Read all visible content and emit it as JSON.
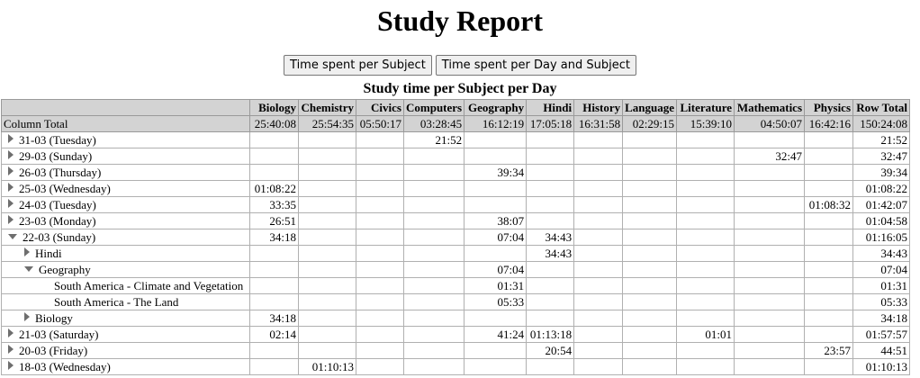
{
  "title": "Study Report",
  "buttons": {
    "per_subject": "Time spent per Subject",
    "per_day_subject": "Time spent per Day and Subject"
  },
  "table_caption": "Study time per Subject per Day",
  "columns": [
    "Biology",
    "Chemistry",
    "Civics",
    "Computers",
    "Geography",
    "Hindi",
    "History",
    "Language",
    "Literature",
    "Mathematics",
    "Physics",
    "Row Total"
  ],
  "totals": {
    "label": "Column Total",
    "values": [
      "25:40:08",
      "25:54:35",
      "05:50:17",
      "03:28:45",
      "16:12:19",
      "17:05:18",
      "16:31:58",
      "02:29:15",
      "15:39:10",
      "04:50:07",
      "16:42:16",
      "150:24:08"
    ]
  },
  "rows": [
    {
      "label": "31-03 (Tuesday)",
      "level": 0,
      "toggle": "closed",
      "cells": [
        "",
        "",
        "",
        "21:52",
        "",
        "",
        "",
        "",
        "",
        "",
        "",
        "21:52"
      ]
    },
    {
      "label": "29-03 (Sunday)",
      "level": 0,
      "toggle": "closed",
      "cells": [
        "",
        "",
        "",
        "",
        "",
        "",
        "",
        "",
        "",
        "32:47",
        "",
        "32:47"
      ]
    },
    {
      "label": "26-03 (Thursday)",
      "level": 0,
      "toggle": "closed",
      "cells": [
        "",
        "",
        "",
        "",
        "39:34",
        "",
        "",
        "",
        "",
        "",
        "",
        "39:34"
      ]
    },
    {
      "label": "25-03 (Wednesday)",
      "level": 0,
      "toggle": "closed",
      "cells": [
        "01:08:22",
        "",
        "",
        "",
        "",
        "",
        "",
        "",
        "",
        "",
        "",
        "01:08:22"
      ]
    },
    {
      "label": "24-03 (Tuesday)",
      "level": 0,
      "toggle": "closed",
      "cells": [
        "33:35",
        "",
        "",
        "",
        "",
        "",
        "",
        "",
        "",
        "",
        "01:08:32",
        "01:42:07"
      ]
    },
    {
      "label": "23-03 (Monday)",
      "level": 0,
      "toggle": "closed",
      "cells": [
        "26:51",
        "",
        "",
        "",
        "38:07",
        "",
        "",
        "",
        "",
        "",
        "",
        "01:04:58"
      ]
    },
    {
      "label": "22-03 (Sunday)",
      "level": 0,
      "toggle": "open",
      "cells": [
        "34:18",
        "",
        "",
        "",
        "07:04",
        "34:43",
        "",
        "",
        "",
        "",
        "",
        "01:16:05"
      ]
    },
    {
      "label": "Hindi",
      "level": 1,
      "toggle": "closed",
      "cells": [
        "",
        "",
        "",
        "",
        "",
        "34:43",
        "",
        "",
        "",
        "",
        "",
        "34:43"
      ]
    },
    {
      "label": "Geography",
      "level": 1,
      "toggle": "open",
      "cells": [
        "",
        "",
        "",
        "",
        "07:04",
        "",
        "",
        "",
        "",
        "",
        "",
        "07:04"
      ]
    },
    {
      "label": "South America - Climate and Vegetation",
      "level": 2,
      "toggle": "none",
      "cells": [
        "",
        "",
        "",
        "",
        "01:31",
        "",
        "",
        "",
        "",
        "",
        "",
        "01:31"
      ]
    },
    {
      "label": "South America - The Land",
      "level": 2,
      "toggle": "none",
      "cells": [
        "",
        "",
        "",
        "",
        "05:33",
        "",
        "",
        "",
        "",
        "",
        "",
        "05:33"
      ]
    },
    {
      "label": "Biology",
      "level": 1,
      "toggle": "closed",
      "cells": [
        "34:18",
        "",
        "",
        "",
        "",
        "",
        "",
        "",
        "",
        "",
        "",
        "34:18"
      ]
    },
    {
      "label": "21-03 (Saturday)",
      "level": 0,
      "toggle": "closed",
      "cells": [
        "02:14",
        "",
        "",
        "",
        "41:24",
        "01:13:18",
        "",
        "",
        "01:01",
        "",
        "",
        "01:57:57"
      ]
    },
    {
      "label": "20-03 (Friday)",
      "level": 0,
      "toggle": "closed",
      "cells": [
        "",
        "",
        "",
        "",
        "",
        "20:54",
        "",
        "",
        "",
        "",
        "23:57",
        "44:51"
      ]
    },
    {
      "label": "18-03 (Wednesday)",
      "level": 0,
      "toggle": "closed",
      "cells": [
        "",
        "01:10:13",
        "",
        "",
        "",
        "",
        "",
        "",
        "",
        "",
        "",
        "01:10:13"
      ]
    }
  ]
}
